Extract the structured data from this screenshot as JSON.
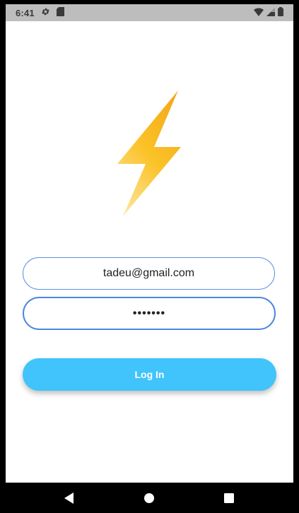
{
  "status_bar": {
    "time": "6:41",
    "icons": [
      "gear-icon",
      "sd-card-icon",
      "wifi-icon",
      "signal-icon",
      "battery-icon"
    ]
  },
  "logo": {
    "icon": "lightning-bolt-icon",
    "colors": [
      "#f3a91c",
      "#fbc93a",
      "#fdd66a"
    ]
  },
  "form": {
    "email_value": "tadeu@gmail.com",
    "password_value": "•••••••"
  },
  "login_button": {
    "label": "Log In",
    "color": "#41c3fb"
  },
  "nav_bar": {
    "buttons": [
      "back-icon",
      "home-icon",
      "recents-icon"
    ]
  }
}
